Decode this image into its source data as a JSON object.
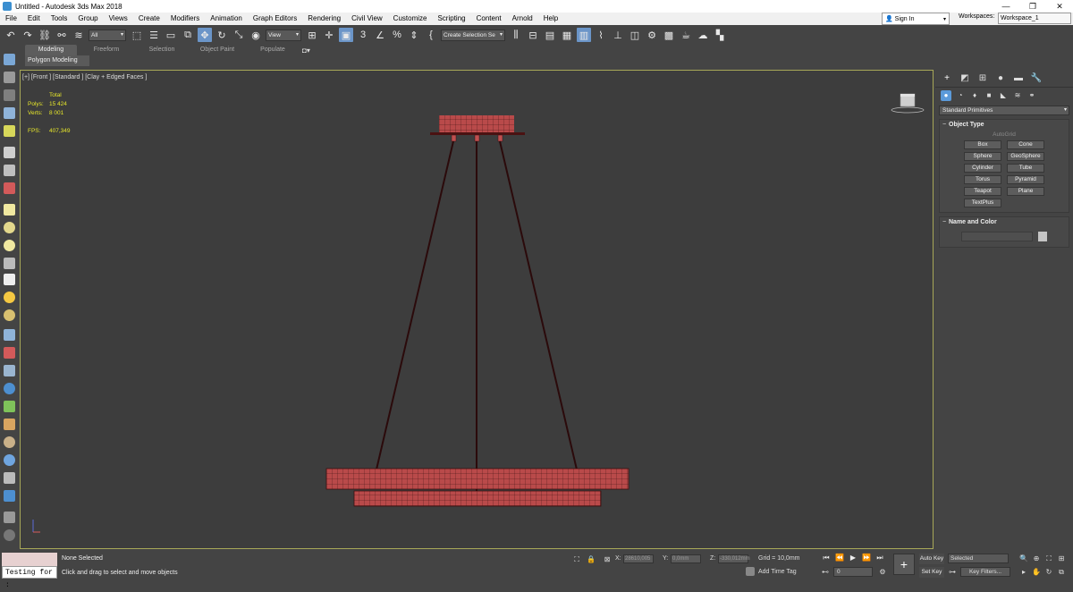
{
  "window": {
    "title": "Untitled - Autodesk 3ds Max 2018",
    "minimize": "—",
    "maximize": "❐",
    "close": "✕"
  },
  "menu": [
    "File",
    "Edit",
    "Tools",
    "Group",
    "Views",
    "Create",
    "Modifiers",
    "Animation",
    "Graph Editors",
    "Rendering",
    "Civil View",
    "Customize",
    "Scripting",
    "Content",
    "Arnold",
    "Help"
  ],
  "account": {
    "sign_in": "Sign In",
    "workspaces_label": "Workspaces:",
    "workspace": "Workspace_1"
  },
  "toolbar": {
    "selection_filter": "All",
    "ref_coord": "View",
    "named_selection": "Create Selection Se"
  },
  "ribbon": {
    "tabs": [
      "Modeling",
      "Freeform",
      "Selection",
      "Object Paint",
      "Populate"
    ],
    "active": "Modeling",
    "sub": "Polygon Modeling"
  },
  "viewport": {
    "label": "[+] [Front ] [Standard ] [Clay + Edged Faces ]",
    "stats": {
      "total_label": "Total",
      "polys_label": "Polys:",
      "polys": "15 424",
      "verts_label": "Verts:",
      "verts": "8 001",
      "fps_label": "FPS:",
      "fps": "407,349"
    }
  },
  "command_panel": {
    "category": "Standard Primitives",
    "object_type_title": "Object Type",
    "autogrid": "AutoGrid",
    "primitives": [
      "Box",
      "Cone",
      "Sphere",
      "GeoSphere",
      "Cylinder",
      "Tube",
      "Torus",
      "Pyramid",
      "Teapot",
      "Plane",
      "TextPlus"
    ],
    "name_color_title": "Name and Color"
  },
  "status": {
    "selection": "None Selected",
    "hint": "Click and drag to select and move objects",
    "script_listener": "Testing for :",
    "x_label": "X:",
    "x": "28610,005",
    "y_label": "Y:",
    "y": "0,0mm",
    "z_label": "Z:",
    "z": "-330,012mm",
    "grid": "Grid = 10,0mm",
    "add_time_tag": "Add Time Tag",
    "frame": "0",
    "auto_key": "Auto Key",
    "set_key": "Set Key",
    "key_mode": "Selected",
    "key_filters": "Key Filters..."
  }
}
